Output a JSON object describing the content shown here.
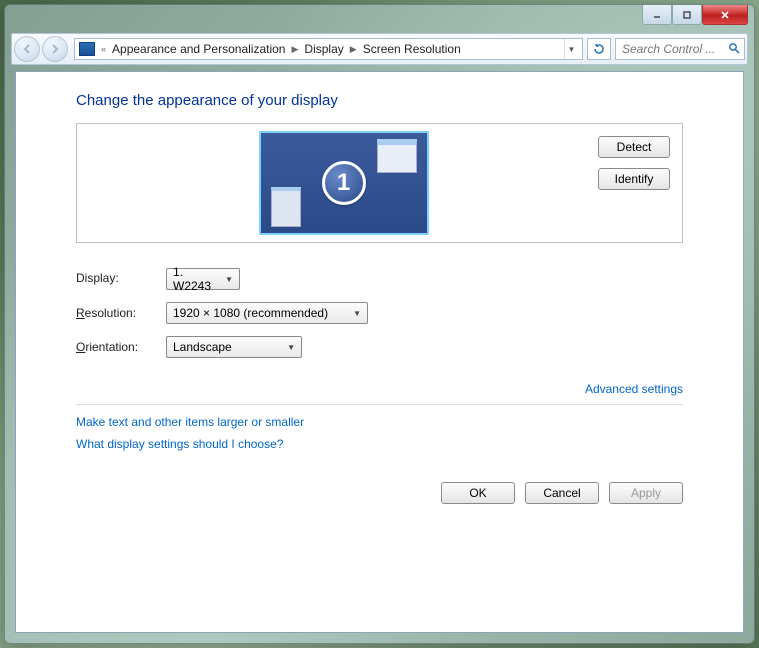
{
  "breadcrumb": {
    "prefix": "«",
    "items": [
      "Appearance and Personalization",
      "Display",
      "Screen Resolution"
    ]
  },
  "search": {
    "placeholder": "Search Control ..."
  },
  "heading": "Change the appearance of your display",
  "monitor": {
    "number": "1"
  },
  "sideButtons": {
    "detect": "Detect",
    "identify": "Identify"
  },
  "form": {
    "displayLabel": "Display:",
    "displayValue": "1. W2243",
    "resolutionLabel": "Resolution:",
    "resolutionValue": "1920 × 1080 (recommended)",
    "orientationLabel": "Orientation:",
    "orientationValue": "Landscape"
  },
  "links": {
    "advanced": "Advanced settings",
    "larger": "Make text and other items larger or smaller",
    "help": "What display settings should I choose?"
  },
  "buttons": {
    "ok": "OK",
    "cancel": "Cancel",
    "apply": "Apply"
  }
}
